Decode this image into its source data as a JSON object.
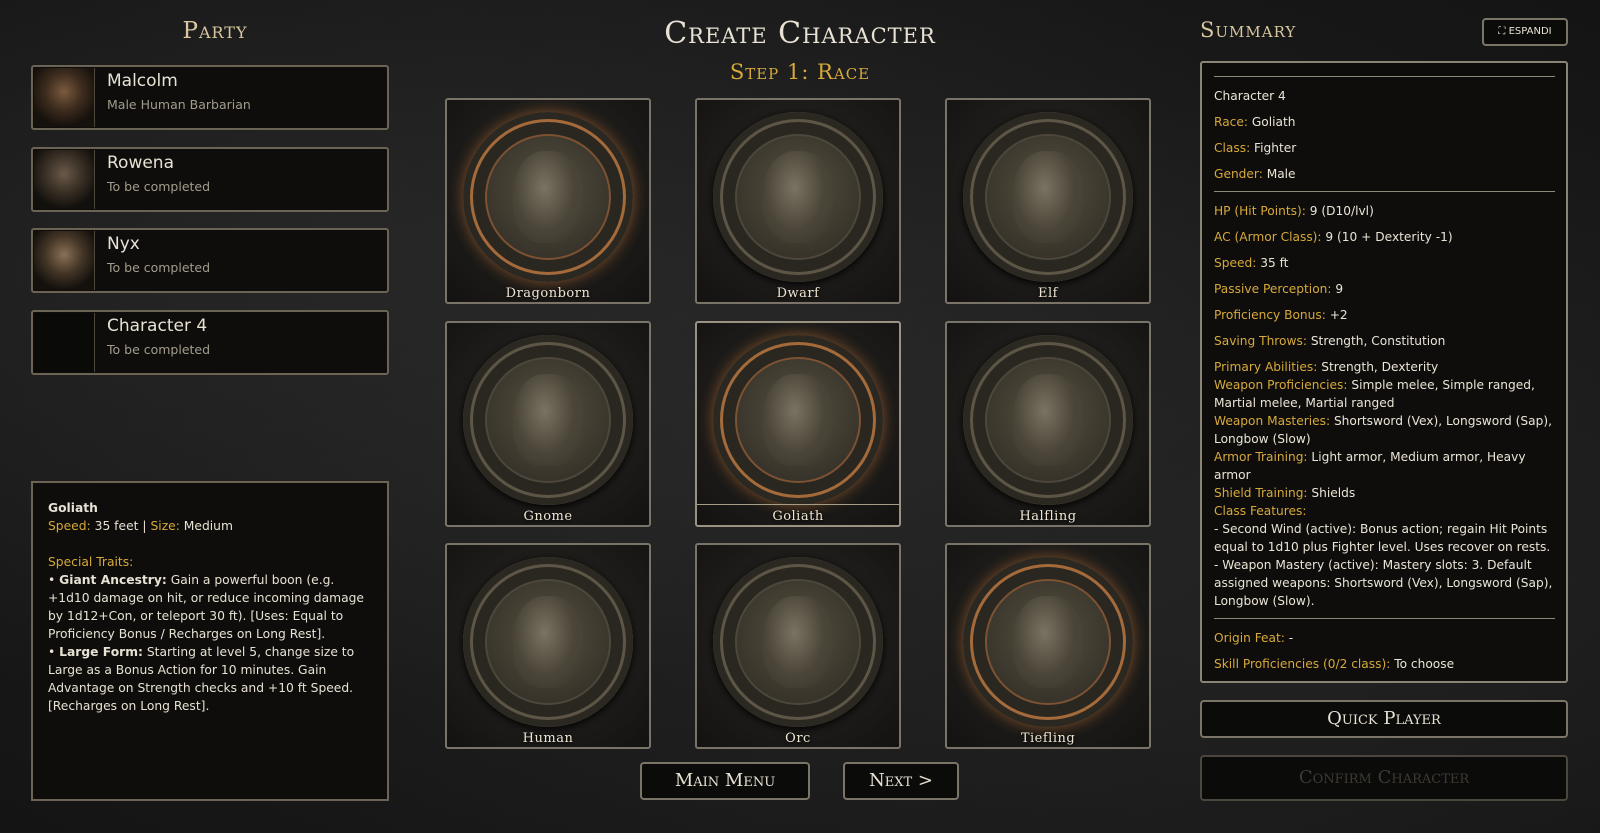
{
  "party": {
    "title": "Party",
    "members": [
      {
        "name": "Malcolm",
        "desc": "Male Human Barbarian"
      },
      {
        "name": "Rowena",
        "desc": "To be completed"
      },
      {
        "name": "Nyx",
        "desc": "To be completed"
      },
      {
        "name": "Character 4",
        "desc": "To be completed"
      }
    ]
  },
  "race_info": {
    "name": "Goliath",
    "speed_label": "Speed:",
    "speed_value": "35 feet",
    "sep": "|",
    "size_label": "Size:",
    "size_value": "Medium",
    "traits_heading": "Special Traits:",
    "trait1_name": "Giant Ancestry:",
    "trait1_text": "Gain a powerful boon (e.g. +1d10 damage on hit, or reduce incoming damage by 1d12+Con, or teleport 30 ft). [Uses: Equal to Proficiency Bonus / Recharges on Long Rest].",
    "trait2_name": "Large Form:",
    "trait2_text": "Starting at level 5, change size to Large as a Bonus Action for 10 minutes. Gain Advantage on Strength checks and +10 ft Speed. [Recharges on Long Rest]."
  },
  "center": {
    "title": "Create Character",
    "step": "Step 1: Race",
    "races": [
      "Dragonborn",
      "Dwarf",
      "Elf",
      "Gnome",
      "Goliath",
      "Halfling",
      "Human",
      "Orc",
      "Tiefling"
    ],
    "main_menu": "Main Menu",
    "next": "Next >"
  },
  "summary": {
    "title": "Summary",
    "expand": "⛶ ESPANDI",
    "character": "Character 4",
    "race_label": "Race:",
    "race_value": "Goliath",
    "class_label": "Class:",
    "class_value": "Fighter",
    "gender_label": "Gender:",
    "gender_value": "Male",
    "hp_label": "HP (Hit Points):",
    "hp_value": "9 (D10/lvl)",
    "ac_label": "AC (Armor Class):",
    "ac_value": "9 (10 + Dexterity -1)",
    "speed_label": "Speed:",
    "speed_value": "35 ft",
    "pp_label": "Passive Perception:",
    "pp_value": "9",
    "pb_label": "Proficiency Bonus:",
    "pb_value": "+2",
    "st_label": "Saving Throws:",
    "st_value": "Strength, Constitution",
    "pa_label": "Primary Abilities:",
    "pa_value": "Strength, Dexterity",
    "wp_label": "Weapon Proficiencies:",
    "wp_value": "Simple melee, Simple ranged, Martial melee, Martial ranged",
    "wm_label": "Weapon Masteries:",
    "wm_value": "Shortsword (Vex), Longsword (Sap), Longbow (Slow)",
    "at_label": "Armor Training:",
    "at_value": "Light armor, Medium armor, Heavy armor",
    "sh_label": "Shield Training:",
    "sh_value": "Shields",
    "cf_label": "Class Features:",
    "cf_1": "- Second Wind (active): Bonus action; regain Hit Points equal to 1d10 plus Fighter level. Uses recover on rests.",
    "cf_2": "- Weapon Mastery (active): Mastery slots: 3. Default assigned weapons: Shortsword (Vex), Longsword (Sap), Longbow (Slow).",
    "of_label": "Origin Feat:",
    "of_value": "-",
    "sp_label": "Skill Proficiencies (0/2 class):",
    "sp_value": "To choose"
  },
  "buttons": {
    "quick_player": "Quick Player",
    "confirm": "Confirm Character"
  },
  "colors": {
    "accent": "#d6a93a",
    "border": "#7b7567",
    "panel": "#0e0d0b"
  }
}
